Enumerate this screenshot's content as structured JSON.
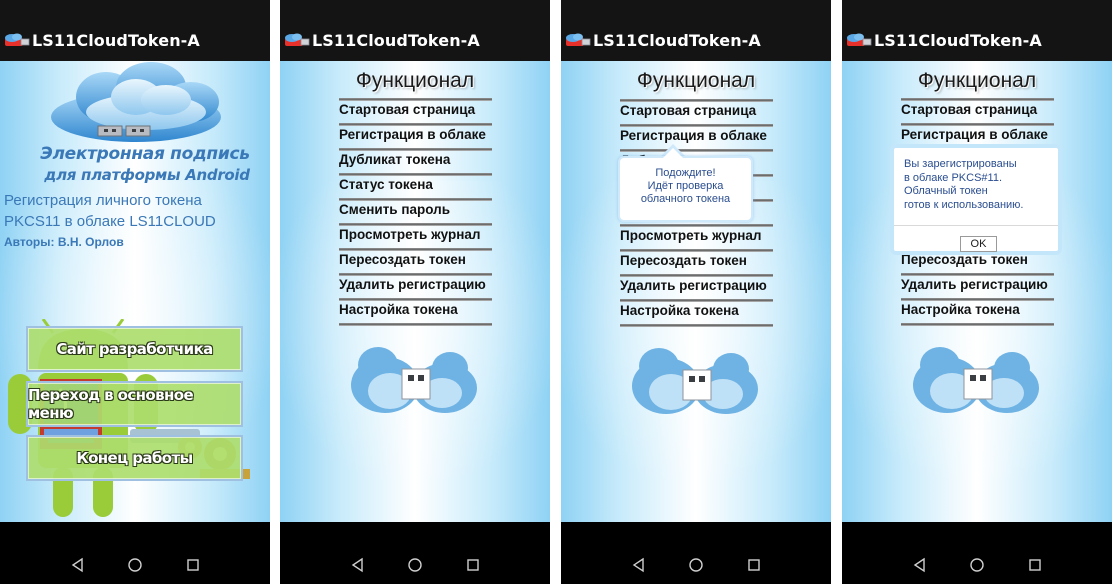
{
  "app": {
    "title": "LS11CloudToken-A"
  },
  "screen1": {
    "tagline_1": "Электронная подпись",
    "tagline_2": "для платформы Android",
    "reg_line_1": "Регистрация личного токена",
    "reg_line_2": "PKCS11 в облаке LS11CLOUD",
    "authors": "Авторы: В.Н. Орлов",
    "buttons": [
      {
        "label": "Сайт разработчика"
      },
      {
        "label": "Переход в основное меню"
      },
      {
        "label": "Конец работы"
      }
    ]
  },
  "menu": {
    "heading": "Функционал",
    "items": [
      "Стартовая страница",
      "Регистрация в облаке",
      "Дубликат токена",
      "Статус токена",
      "Сменить пароль",
      "Просмотреть журнал",
      "Пересоздать токен",
      "Удалить регистрацию",
      "Настройка токена"
    ]
  },
  "progress_popup": {
    "line_1": "Подождите!",
    "line_2": "Идёт проверка",
    "line_3": "облачного токена"
  },
  "result_dialog": {
    "line_1": "Вы зарегистрированы",
    "line_2": "в облаке PKCS#11.",
    "line_3": "Облачный токен",
    "line_4": "готов к использованию.",
    "ok_label": "OK"
  },
  "nav": {
    "back": "back-icon",
    "home": "home-icon",
    "recents": "recents-icon"
  },
  "colors": {
    "accent_text": "#3a78b7",
    "button_green": "#addd6e",
    "titlebar": "#141414"
  }
}
